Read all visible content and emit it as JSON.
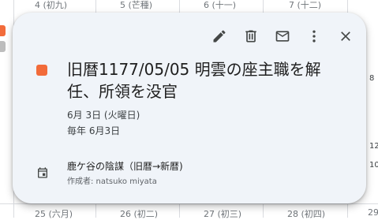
{
  "background": {
    "top_row": [
      "4 (初九)",
      "5 (芒種)",
      "6 (十一)",
      "7 (十二)"
    ],
    "bottom_row": [
      "25 (六月)",
      "26 (初二)",
      "27 (初三)",
      "28 (初四)",
      "29"
    ],
    "right_edge": [
      "8",
      "12",
      "10:"
    ]
  },
  "event": {
    "color": "#f26b3a",
    "title": "旧暦1177/05/05 明雲の座主職を解任、所領を没官",
    "date_line": "6月 3日 (火曜日)",
    "recurrence": "毎年 6月3日",
    "calendar_name": "鹿ケ谷の陰謀（旧暦→新暦)",
    "creator": "作成者: natsuko miyata"
  },
  "toolbar": {
    "icons": [
      "edit-icon",
      "delete-icon",
      "email-icon",
      "more-options-icon",
      "close-icon"
    ]
  }
}
